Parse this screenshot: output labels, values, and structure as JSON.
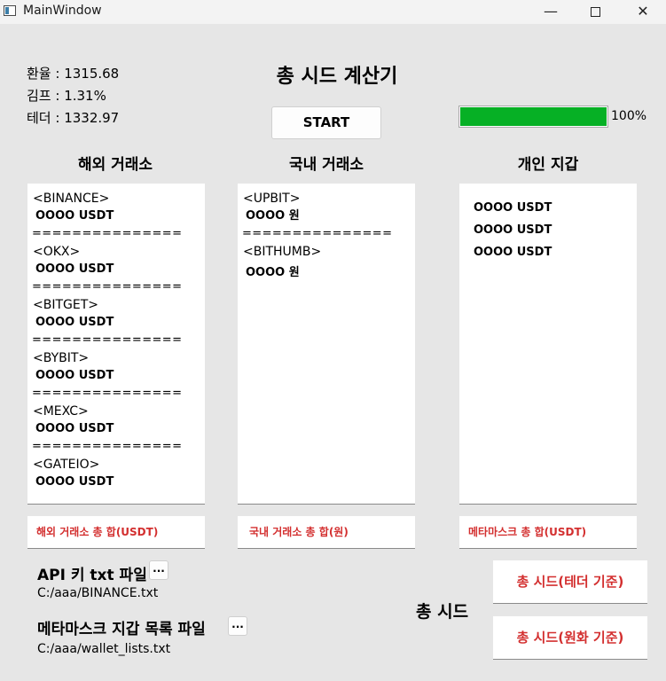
{
  "window": {
    "title": "MainWindow",
    "minimize_glyph": "—",
    "close_glyph": "✕"
  },
  "rates": [
    {
      "text": "환율 : 1315.68"
    },
    {
      "text": "김프 : 1.31%"
    },
    {
      "text": "테더 : 1332.97"
    }
  ],
  "header": {
    "title": "총 시드 계산기",
    "start_label": "START"
  },
  "progress": {
    "value": 100,
    "label": "100%",
    "color": "#06b025"
  },
  "columns": {
    "overseas": {
      "heading": "해외 거래소",
      "lines": [
        "<BINANCE>",
        " OOOO USDT",
        "===============",
        "<OKX>",
        " OOOO USDT",
        "===============",
        "<BITGET>",
        " OOOO USDT",
        "===============",
        "<BYBIT>",
        " OOOO USDT",
        "===============",
        "<MEXC>",
        " OOOO USDT",
        "===============",
        "<GATEIO>",
        " OOOO USDT"
      ],
      "total_label": "해외 거래소 총 합(USDT)"
    },
    "domestic": {
      "heading": "국내 거래소",
      "lines": [
        "<UPBIT>",
        " OOOO 원",
        "===============",
        "<BITHUMB>",
        " OOOO 원"
      ],
      "total_label": "국내 거래소 총 합(원)"
    },
    "wallet": {
      "heading": "개인 지갑",
      "lines": [
        "OOOO USDT",
        "OOOO USDT",
        "OOOO USDT"
      ],
      "total_label": "메타마스크 총 합(USDT)"
    }
  },
  "files": {
    "api_label": "API 키 txt 파일",
    "api_path": "C:/aaa/BINANCE.txt",
    "wallet_label": "메타마스크 지갑 목록 파일",
    "wallet_path": "C:/aaa/wallet_lists.txt",
    "browse_label": "..."
  },
  "totals": {
    "label": "총 시드",
    "usdt_label": "총 시드(테더 기준)",
    "krw_label": "총 시드(원화 기준)"
  },
  "colors": {
    "accent_red": "#d32f2f"
  }
}
